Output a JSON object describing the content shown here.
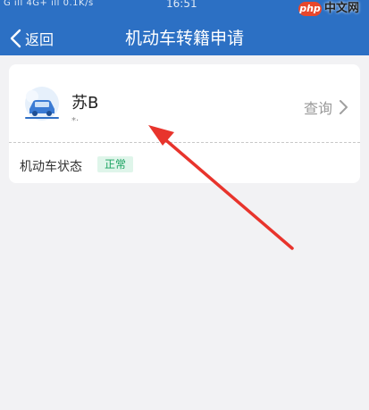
{
  "statusbar": {
    "left": "G ıll 4G+ ıll 0.1K/s",
    "time": "16:51",
    "watermark_badge": "php",
    "watermark_text": "中文网"
  },
  "header": {
    "back_label": "返回",
    "title": "机动车转籍申请"
  },
  "card": {
    "plate": "苏B",
    "subtext": "*·",
    "query_label": "查询",
    "status_label": "机动车状态",
    "status_value": "正常"
  },
  "colors": {
    "header_bg": "#2c70c4",
    "status_green": "#1aa260",
    "annotation_arrow": "#e8342c"
  },
  "icons": [
    "back-chevron-icon",
    "car-icon",
    "chevron-right-icon",
    "annotation-arrow-icon"
  ]
}
